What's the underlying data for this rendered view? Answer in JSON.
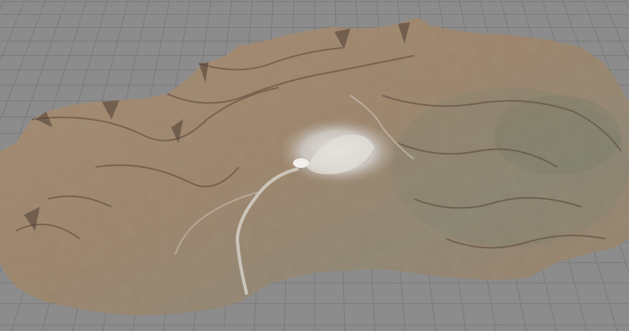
{
  "viewport": {
    "background_color": "#8c8c8c",
    "grid_line_color": "#7a7a7a"
  },
  "terrain": {
    "description_icon": "3d-terrain-mesh",
    "base_color": "#a38a73",
    "ridge_color": "#6e5a48",
    "highlight_color": "#d8d2cc",
    "vegetation_tint": "#8a8a78"
  }
}
